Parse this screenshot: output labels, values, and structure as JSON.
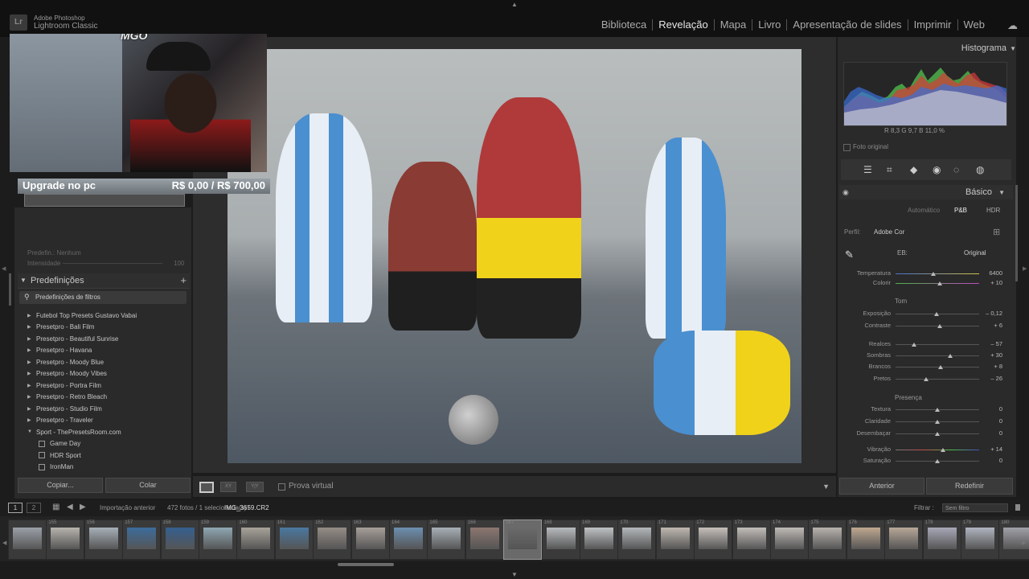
{
  "app": {
    "logo": "Lr",
    "name": "Adobe Photoshop",
    "subtitle": "Lightroom Classic"
  },
  "modules": [
    "Biblioteca",
    "Revelação",
    "Mapa",
    "Livro",
    "Apresentação de slides",
    "Imprimir",
    "Web"
  ],
  "active_module": "Revelação",
  "overlay": {
    "cam_logo": "MGO",
    "upgrade_label": "Upgrade no pc",
    "upgrade_value": "R$ 0,00 / R$ 700,00"
  },
  "left_panel": {
    "preset_row": "Predefin.: Nenhum",
    "intensity_label": "Intensidade",
    "intensity_value": "100",
    "presets_title": "Predefinições",
    "filter_label": "Predefinições de filtros",
    "presets": [
      "Futebol Top Presets Gustavo Vabai",
      "Presetpro - Bali Film",
      "Presetpro - Beautiful Sunrise",
      "Presetpro - Havana",
      "Presetpro - Moody Blue",
      "Presetpro - Moody Vibes",
      "Presetpro - Portra Film",
      "Presetpro - Retro Bleach",
      "Presetpro - Studio Film",
      "Presetpro - Traveler",
      "Sport - ThePresetsRoom.com"
    ],
    "sub_presets": [
      "Game Day",
      "HDR Sport",
      "IronMan"
    ],
    "copy_button": "Copiar...",
    "paste_button": "Colar"
  },
  "toolbar": {
    "compare_label": "XY",
    "yy_label": "Y|Y",
    "soft_proof_label": "Prova virtual"
  },
  "right_panel": {
    "histogram_title": "Histograma",
    "readout": "R  8,3  G  9,7  B  11,0  %",
    "original_photo": "Foto original",
    "basic_title": "Básico",
    "treatment": {
      "auto": "Automático",
      "color": "P&B",
      "hdr": "HDR"
    },
    "profile_label": "Perfil:",
    "profile_value": "Adobe Cor",
    "wb_label": "EB:",
    "wb_value": "Original",
    "groups": {
      "tone": "Tom",
      "presence": "Presença"
    },
    "sliders": [
      {
        "label": "Temperatura",
        "value": "6400",
        "pos": 0.45
      },
      {
        "label": "Colorir",
        "value": "+ 10",
        "pos": 0.53
      },
      {
        "label": "Exposição",
        "value": "– 0,12",
        "pos": 0.49
      },
      {
        "label": "Contraste",
        "value": "+ 6",
        "pos": 0.53
      },
      {
        "label": "Realces",
        "value": "– 57",
        "pos": 0.22
      },
      {
        "label": "Sombras",
        "value": "+ 30",
        "pos": 0.65
      },
      {
        "label": "Brancos",
        "value": "+ 8",
        "pos": 0.54
      },
      {
        "label": "Pretos",
        "value": "– 26",
        "pos": 0.37
      },
      {
        "label": "Textura",
        "value": "0",
        "pos": 0.5
      },
      {
        "label": "Claridade",
        "value": "0",
        "pos": 0.5
      },
      {
        "label": "Desembaçar",
        "value": "0",
        "pos": 0.5
      },
      {
        "label": "Vibração",
        "value": "+ 14",
        "pos": 0.57
      },
      {
        "label": "Saturação",
        "value": "0",
        "pos": 0.5
      }
    ],
    "previous_button": "Anterior",
    "reset_button": "Redefinir"
  },
  "filmstrip_bar": {
    "view1": "1",
    "view2": "2",
    "source": "Importação anterior",
    "count": "472 fotos / 1 selecionada(s) /",
    "filename": "IMG_3659.CR2",
    "filter_label": "Filtrar :",
    "filter_value": "Sem filtro"
  },
  "filmstrip": {
    "numbers": [
      "",
      "155",
      "156",
      "157",
      "158",
      "159",
      "160",
      "161",
      "162",
      "163",
      "164",
      "165",
      "166",
      "167",
      "168",
      "169",
      "170",
      "171",
      "172",
      "173",
      "174",
      "175",
      "176",
      "177",
      "178",
      "179",
      "180"
    ],
    "selected_index": 13
  },
  "colors": {
    "accent_red": "#d83a3a",
    "histogram_blue": "#3a6fd8",
    "histogram_green": "#4cb04a"
  }
}
